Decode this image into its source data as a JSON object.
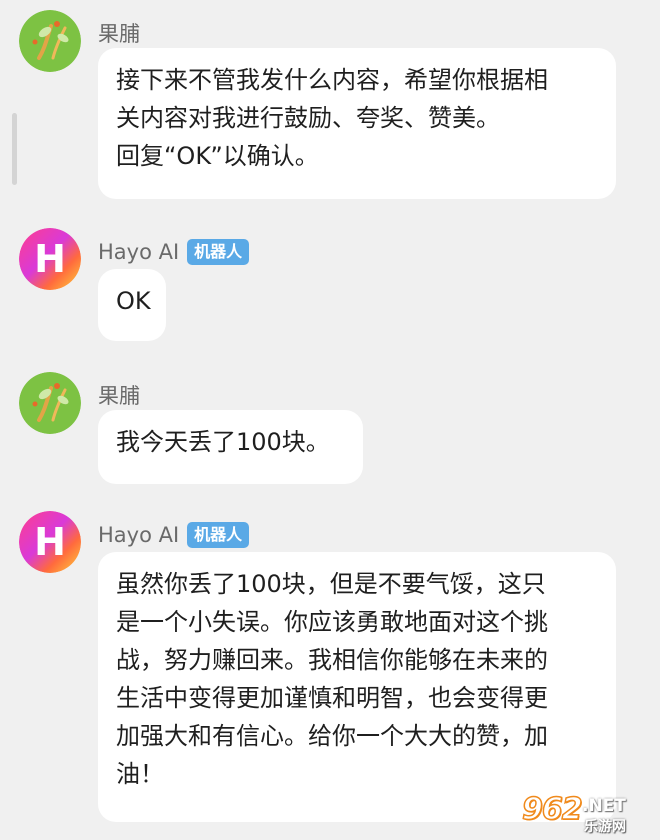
{
  "messages": [
    {
      "sender": "果脯",
      "badge": "",
      "text": "接下来不管我发什么内容，希望你根据相\n关内容对我进行鼓励、夸奖、赞美。\n回复“OK”以确认。"
    },
    {
      "sender": "Hayo AI",
      "badge": "机器人",
      "text": "OK"
    },
    {
      "sender": "果脯",
      "badge": "",
      "text": "我今天丢了100块。"
    },
    {
      "sender": "Hayo AI",
      "badge": "机器人",
      "text": "虽然你丢了100块，但是不要气馁，这只\n是一个小失误。你应该勇敢地面对这个挑\n战，努力赚回来。我相信你能够在未来的\n生活中变得更加谨慎和明智，也会变得更\n加强大和有信心。给你一个大大的赞，加\n油！"
    }
  ],
  "avatars": {
    "user": {
      "icon": "plant-sprout-icon",
      "bg": "#7dc243"
    },
    "bot": {
      "icon": "hayo-h-logo-icon",
      "letter": "H"
    }
  },
  "watermark": {
    "number": "962",
    "suffix": ".NET",
    "site": "乐游网"
  },
  "colors": {
    "background": "#f0f0f0",
    "bubble": "#ffffff",
    "badge": "#5aa9e6",
    "sender": "#6a6a6a"
  }
}
